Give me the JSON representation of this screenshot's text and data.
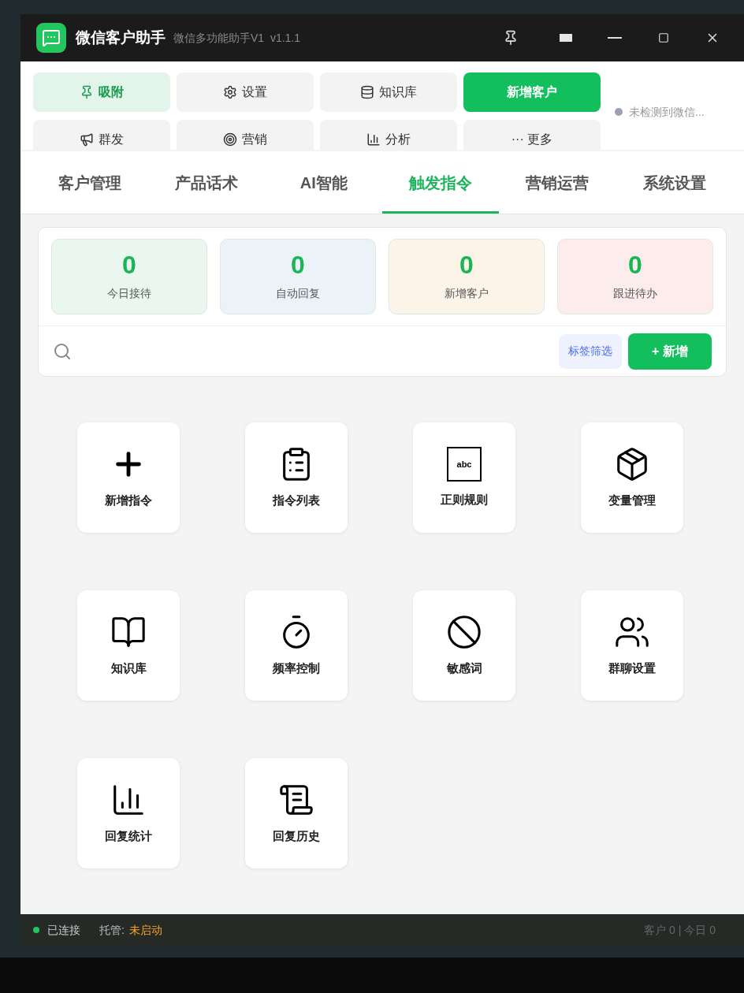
{
  "window": {
    "title": "微信客户助手",
    "subtitle": "微信多功能助手V1  v1.1.1"
  },
  "toolbar": {
    "buttons": [
      {
        "label": "吸附",
        "kind": "pin",
        "selected": true
      },
      {
        "label": "设置",
        "kind": "gear",
        "selected": false
      },
      {
        "label": "知识库",
        "kind": "book",
        "selected": false
      },
      {
        "label": "新增客户",
        "kind": "primary",
        "selected": false
      },
      {
        "label": "群发",
        "kind": "megaphone",
        "selected": false
      },
      {
        "label": "营销",
        "kind": "target",
        "selected": false
      },
      {
        "label": "分析",
        "kind": "chart",
        "selected": false
      },
      {
        "label": "··· 更多",
        "kind": "more",
        "selected": false
      }
    ],
    "status": {
      "text": "未检测到微信...",
      "color": "#9aa3b5"
    }
  },
  "tabs": [
    {
      "label": "客户管理",
      "selected": false
    },
    {
      "label": "产品话术",
      "selected": false
    },
    {
      "label": "AI智能",
      "selected": false
    },
    {
      "label": "触发指令",
      "selected": true
    },
    {
      "label": "营销运营",
      "selected": false
    },
    {
      "label": "系统设置",
      "selected": false
    }
  ],
  "stats": [
    {
      "value": "0",
      "label": "今日接待",
      "color": "#eaf7ee"
    },
    {
      "value": "0",
      "label": "自动回复",
      "color": "#ecf3f8"
    },
    {
      "value": "0",
      "label": "新增客户",
      "color": "#fdf4e9"
    },
    {
      "value": "0",
      "label": "跟进待办",
      "color": "#fdecec"
    }
  ],
  "search": {
    "filter_button": "标签筛选",
    "add_button": "+ 新增"
  },
  "tiles": [
    {
      "label": "新增指令",
      "kind": "plus"
    },
    {
      "label": "指令列表",
      "kind": "clipboard"
    },
    {
      "label": "正则规则",
      "kind": "abc",
      "icon_text": "abc"
    },
    {
      "label": "变量管理",
      "kind": "box"
    },
    {
      "label": "知识库",
      "kind": "book"
    },
    {
      "label": "频率控制",
      "kind": "timer"
    },
    {
      "label": "敏感词",
      "kind": "ban"
    },
    {
      "label": "群聊设置",
      "kind": "users"
    },
    {
      "label": "回复统计",
      "kind": "chart"
    },
    {
      "label": "回复历史",
      "kind": "scroll"
    }
  ],
  "status_bar": {
    "connection": "已连接",
    "hosting_label": "托管:",
    "hosting_value": "未启动",
    "counts": "客户 0 | 今日 0"
  }
}
